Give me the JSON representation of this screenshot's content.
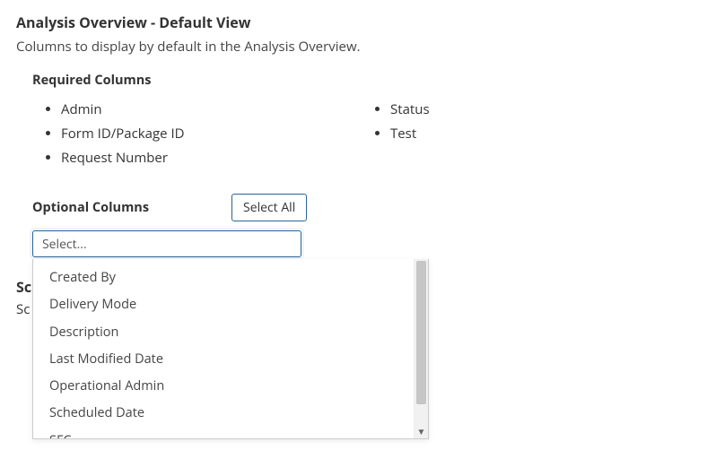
{
  "header": {
    "title": "Analysis Overview - Default View",
    "subtitle": "Columns to display by default in the Analysis Overview."
  },
  "required": {
    "title": "Required Columns",
    "col1": [
      "Admin",
      "Form ID/Package ID",
      "Request Number"
    ],
    "col2": [
      "Status",
      "Test"
    ]
  },
  "optional": {
    "title": "Optional Columns",
    "select_all_label": "Select All",
    "placeholder": "Select...",
    "options": [
      "Created By",
      "Delivery Mode",
      "Description",
      "Last Modified Date",
      "Operational Admin",
      "Scheduled Date",
      "SFC"
    ]
  },
  "obscured": {
    "line1_prefix": "Sc",
    "line2_prefix": "Sc"
  }
}
